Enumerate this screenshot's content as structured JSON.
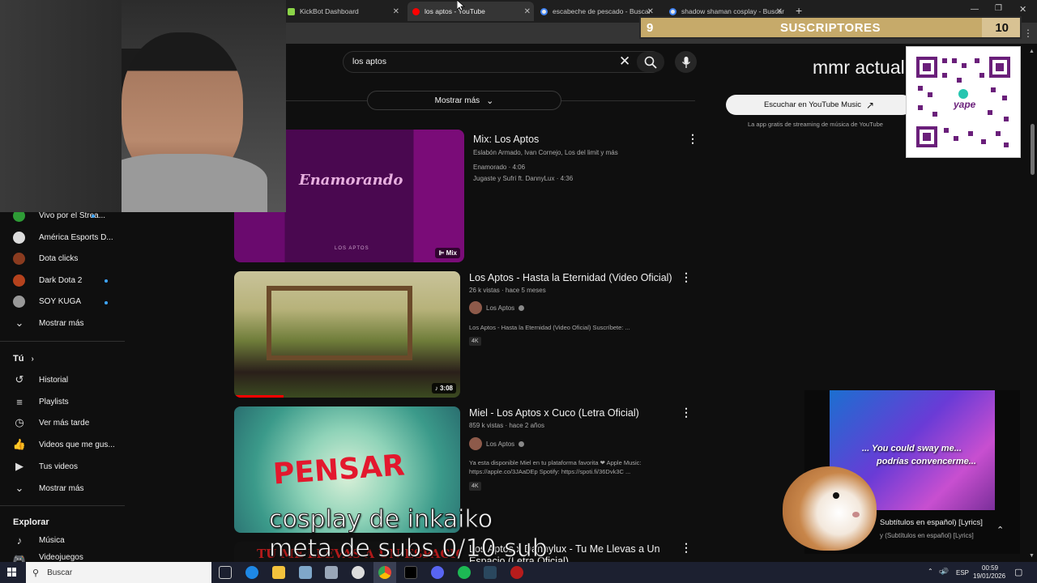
{
  "tabs": [
    {
      "label": "KickBot Dashboard",
      "icon": "kickbot-icon",
      "active": false
    },
    {
      "label": "los aptos - YouTube",
      "icon": "youtube-icon",
      "active": true
    },
    {
      "label": "escabeche de pescado - Buscar",
      "icon": "google-icon",
      "active": false
    },
    {
      "label": "shadow shaman cosplay - Buscar",
      "icon": "google-icon",
      "active": false
    }
  ],
  "search": {
    "query": "los aptos"
  },
  "more_results_label": "Mostrar más",
  "sidebar": {
    "channels": [
      {
        "label": "Vivo por el Strea...",
        "live": true,
        "color": "#2e9c36"
      },
      {
        "label": "América Esports D...",
        "live": false,
        "color": "#dcdcdc"
      },
      {
        "label": "Dota clicks",
        "live": false,
        "color": "#8a3b1f"
      },
      {
        "label": "Dark Dota 2",
        "live": true,
        "color": "#b5421d"
      },
      {
        "label": "SOY KUGA",
        "live": true,
        "color": "#999999"
      }
    ],
    "show_more_1": "Mostrar más",
    "you_header": "Tú",
    "you_items": [
      {
        "label": "Historial",
        "icon": "history-icon"
      },
      {
        "label": "Playlists",
        "icon": "playlist-icon"
      },
      {
        "label": "Ver más tarde",
        "icon": "clock-icon"
      },
      {
        "label": "Videos que me gus...",
        "icon": "thumbs-up-icon"
      },
      {
        "label": "Tus videos",
        "icon": "video-icon"
      }
    ],
    "show_more_2": "Mostrar más",
    "explore_header": "Explorar",
    "explore_items": [
      {
        "label": "Música",
        "icon": "music-icon"
      },
      {
        "label": "Videojuegos",
        "icon": "gamepad-icon"
      }
    ]
  },
  "results": [
    {
      "title": "Mix: Los Aptos",
      "subtitle": "Eslabón Armado, Ivan Cornejo, Los del limit y más",
      "line1": "Enamorado · 4:06",
      "line2": "Jugaste y Sufrí ft. DannyLux · 4:36",
      "thumb_text": "Enamorando",
      "thumb_small": "LOS APTOS",
      "badge": "Mix"
    },
    {
      "title": "Los Aptos - Hasta la Eternidad (Video Oficial)",
      "meta": "26 k vistas · hace 5 meses",
      "channel": "Los Aptos",
      "desc": "Los Aptos - Hasta la Eternidad (Video Oficial) Suscríbete: ...",
      "badge": "4K",
      "duration": "3:08"
    },
    {
      "title": "Miel - Los Aptos x Cuco (Letra Oficial)",
      "meta": "859 k vistas · hace 2 años",
      "channel": "Los Aptos",
      "desc": "Ya esta disponible Miel en tu plataforma favorita ❤ Apple Music: https://apple.co/3JAaDEp Spotify: https://spoti.fi/36Dvk3C ...",
      "badge": "4K",
      "thumb_text": "PENSAR"
    },
    {
      "title": "Los Aptos x Dannylux - Tu Me Llevas a Un Espacio (Letra Oficial)",
      "thumb_text": "TU ME LLEVAS A UN ESPACIO"
    }
  ],
  "right_panel": {
    "mmr_text": "mmr actual",
    "music_button": "Escuchar en YouTube Music",
    "music_caption": "La app gratis de streaming de música de YouTube",
    "qr_brand": "yape"
  },
  "subs_goal": {
    "current": "9",
    "label": "SUSCRIPTORES",
    "target": "10",
    "fraction": 0.9
  },
  "mini_player": {
    "lyric1": "... You could sway me...",
    "lyric2": "podrías convencerme...",
    "title": "Subtítulos en español) [Lyrics]",
    "subtitle": "y (Subtítulos en español) [Lyrics]"
  },
  "overlay": {
    "line1": "cosplay de inkaiko",
    "line2": "meta de subs  0/10 sub"
  },
  "taskbar": {
    "search_placeholder": "Buscar",
    "lang": "ESP",
    "time": "00:59",
    "date": "19/01/2026"
  },
  "colors": {
    "accent": "#3ea6ff",
    "youtube_red": "#ff0000",
    "gold": "#d8c293"
  }
}
